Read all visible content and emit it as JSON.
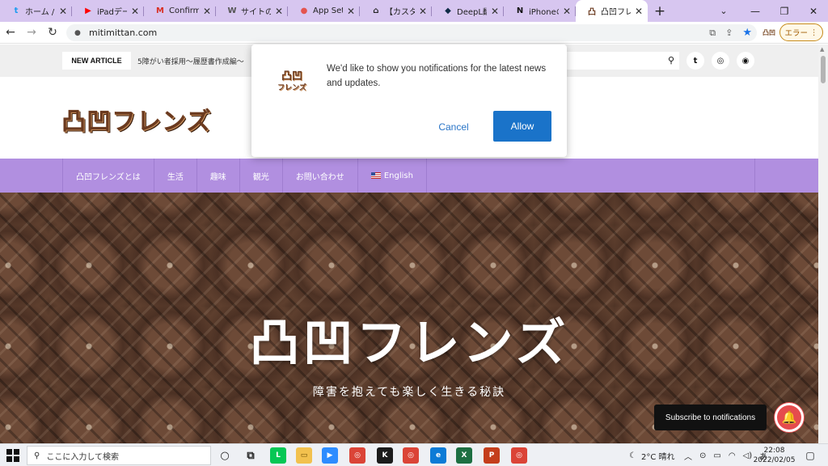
{
  "browser": {
    "tabs": [
      {
        "label": "ホーム / Tw",
        "icon": "twitter-icon",
        "color": "#1d9bf0",
        "glyph": "t"
      },
      {
        "label": "iPadデータ",
        "icon": "youtube-icon",
        "color": "#ff0000",
        "glyph": "▶"
      },
      {
        "label": "Confirmat",
        "icon": "gmail-icon",
        "color": "#d93025",
        "glyph": "M"
      },
      {
        "label": "サイトの更",
        "icon": "wordpress-icon",
        "color": "#555555",
        "glyph": "W"
      },
      {
        "label": "App Settir",
        "icon": "app-icon",
        "color": "#e4544f",
        "glyph": "●"
      },
      {
        "label": "【カスタマイ",
        "icon": "home-icon",
        "color": "#222222",
        "glyph": "⌂"
      },
      {
        "label": "DeepL翻訳",
        "icon": "deepl-icon",
        "color": "#0f2b46",
        "glyph": "◆"
      },
      {
        "label": "iPhoneの",
        "icon": "notion-icon",
        "color": "#111111",
        "glyph": "N"
      },
      {
        "label": "凸凹フレン",
        "icon": "site-icon",
        "color": "#6b3a1f",
        "glyph": "凸"
      }
    ],
    "active_tab": 8,
    "url": "mitimittan.com",
    "error_label": "エラー",
    "colors": {
      "tabstrip": "#d7c6f0",
      "accent": "#1a73e8"
    }
  },
  "site": {
    "new_article_label": "NEW ARTICLE",
    "ticker_text": "5障がい者採用～履歴書作成編～",
    "logo_text": "凸凹フレンズ",
    "nav": [
      {
        "label": "凸凹フレンズとは"
      },
      {
        "label": "生活"
      },
      {
        "label": "趣味"
      },
      {
        "label": "観光"
      },
      {
        "label": "お問い合わせ"
      },
      {
        "label": "English"
      }
    ],
    "hero_title": "凸凹フレンズ",
    "hero_subtitle": "障害を抱えても楽しく生きる秘訣",
    "colors": {
      "nav": "#b18fe0",
      "hero": "#4e3426"
    }
  },
  "popup": {
    "logo_text": "凸凹",
    "logo_sub": "フレンズ",
    "message": "We'd like to show you notifications for the latest news and updates.",
    "cancel_label": "Cancel",
    "allow_label": "Allow",
    "colors": {
      "allow": "#1a73c9"
    }
  },
  "subscribe": {
    "tooltip": "Subscribe to notifications",
    "colors": {
      "bell": "#e54b4d"
    }
  },
  "taskbar": {
    "search_placeholder": "ここに入力して検索",
    "weather": "2°C  晴れ",
    "ime": "あ",
    "time": "22:08",
    "date": "2022/02/05"
  }
}
